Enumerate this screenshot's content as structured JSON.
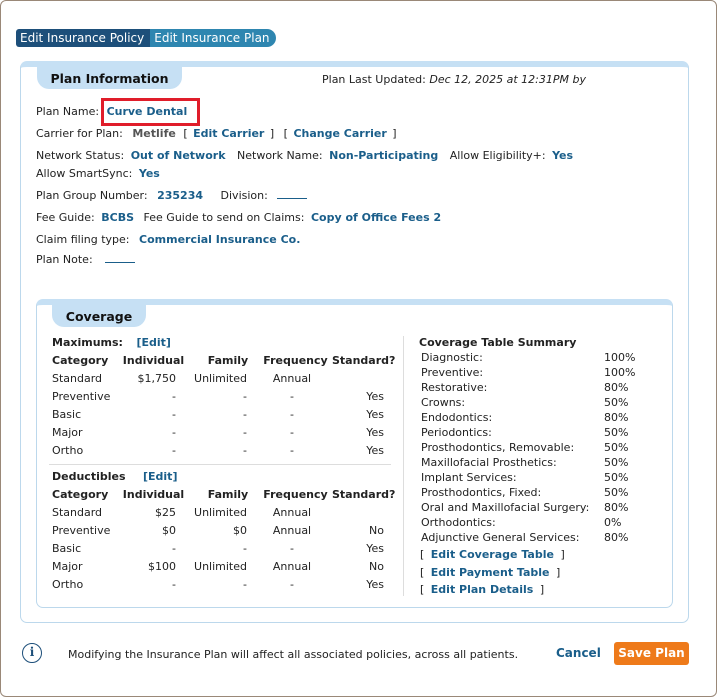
{
  "tabs": {
    "policy": "Edit Insurance Policy",
    "plan": "Edit Insurance Plan"
  },
  "plan_info": {
    "title": "Plan Information",
    "last_updated_label": "Plan Last Updated:",
    "last_updated_value": "Dec 12, 2025 at 12:31PM by",
    "plan_name_label": "Plan Name:",
    "plan_name": "Curve Dental",
    "carrier_label": "Carrier for Plan:",
    "carrier": "Metlife",
    "edit_carrier": "Edit Carrier",
    "change_carrier": "Change Carrier",
    "network_status_label": "Network Status:",
    "network_status": "Out of Network",
    "network_name_label": "Network Name:",
    "network_name": "Non-Participating",
    "eligibility_label": "Allow Eligibility+:",
    "eligibility": "Yes",
    "smartsync_label": "Allow SmartSync:",
    "smartsync": "Yes",
    "group_number_label": "Plan Group Number:",
    "group_number": "235234",
    "division_label": "Division:",
    "fee_guide_label": "Fee Guide:",
    "fee_guide": "BCBS",
    "fee_guide_claims_label": "Fee Guide to send on Claims:",
    "fee_guide_claims": "Copy of Office Fees 2",
    "claim_type_label": "Claim filing type:",
    "claim_type": "Commercial Insurance Co.",
    "plan_note_label": "Plan Note:"
  },
  "coverage": {
    "title": "Coverage",
    "maximums_label": "Maximums:",
    "deductibles_label": "Deductibles",
    "edit_label": "[Edit]",
    "columns": [
      "Category",
      "Individual",
      "Family",
      "Frequency",
      "Standard?"
    ],
    "maximums": [
      [
        "Standard",
        "$1,750",
        "Unlimited",
        "Annual",
        ""
      ],
      [
        "Preventive",
        "-",
        "-",
        "-",
        "Yes"
      ],
      [
        "Basic",
        "-",
        "-",
        "-",
        "Yes"
      ],
      [
        "Major",
        "-",
        "-",
        "-",
        "Yes"
      ],
      [
        "Ortho",
        "-",
        "-",
        "-",
        "Yes"
      ]
    ],
    "deductibles": [
      [
        "Standard",
        "$25",
        "Unlimited",
        "Annual",
        ""
      ],
      [
        "Preventive",
        "$0",
        "$0",
        "Annual",
        "No"
      ],
      [
        "Basic",
        "-",
        "-",
        "-",
        "Yes"
      ],
      [
        "Major",
        "$100",
        "Unlimited",
        "Annual",
        "No"
      ],
      [
        "Ortho",
        "-",
        "-",
        "-",
        "Yes"
      ]
    ],
    "summary_title": "Coverage Table Summary",
    "summary": [
      [
        "Diagnostic:",
        "100%"
      ],
      [
        "Preventive:",
        "100%"
      ],
      [
        "Restorative:",
        "80%"
      ],
      [
        "Crowns:",
        "50%"
      ],
      [
        "Endodontics:",
        "80%"
      ],
      [
        "Periodontics:",
        "50%"
      ],
      [
        "Prosthodontics, Removable:",
        "50%"
      ],
      [
        "Maxillofacial Prosthetics:",
        "50%"
      ],
      [
        "Implant Services:",
        "50%"
      ],
      [
        "Prosthodontics, Fixed:",
        "50%"
      ],
      [
        "Oral and Maxillofacial Surgery:",
        "80%"
      ],
      [
        "Orthodontics:",
        "0%"
      ],
      [
        "Adjunctive General Services:",
        "80%"
      ]
    ],
    "links": {
      "coverage_table": "Edit Coverage Table",
      "payment_table": "Edit Payment Table",
      "plan_details": "Edit Plan Details"
    }
  },
  "footer": {
    "info_icon": "info-icon",
    "message": "Modifying the Insurance Plan will affect all associated policies, across all patients.",
    "cancel": "Cancel",
    "save": "Save Plan"
  },
  "colors": {
    "accent": "#1a5e8a",
    "save": "#ee7a1a",
    "highlight": "#e01d2a"
  }
}
